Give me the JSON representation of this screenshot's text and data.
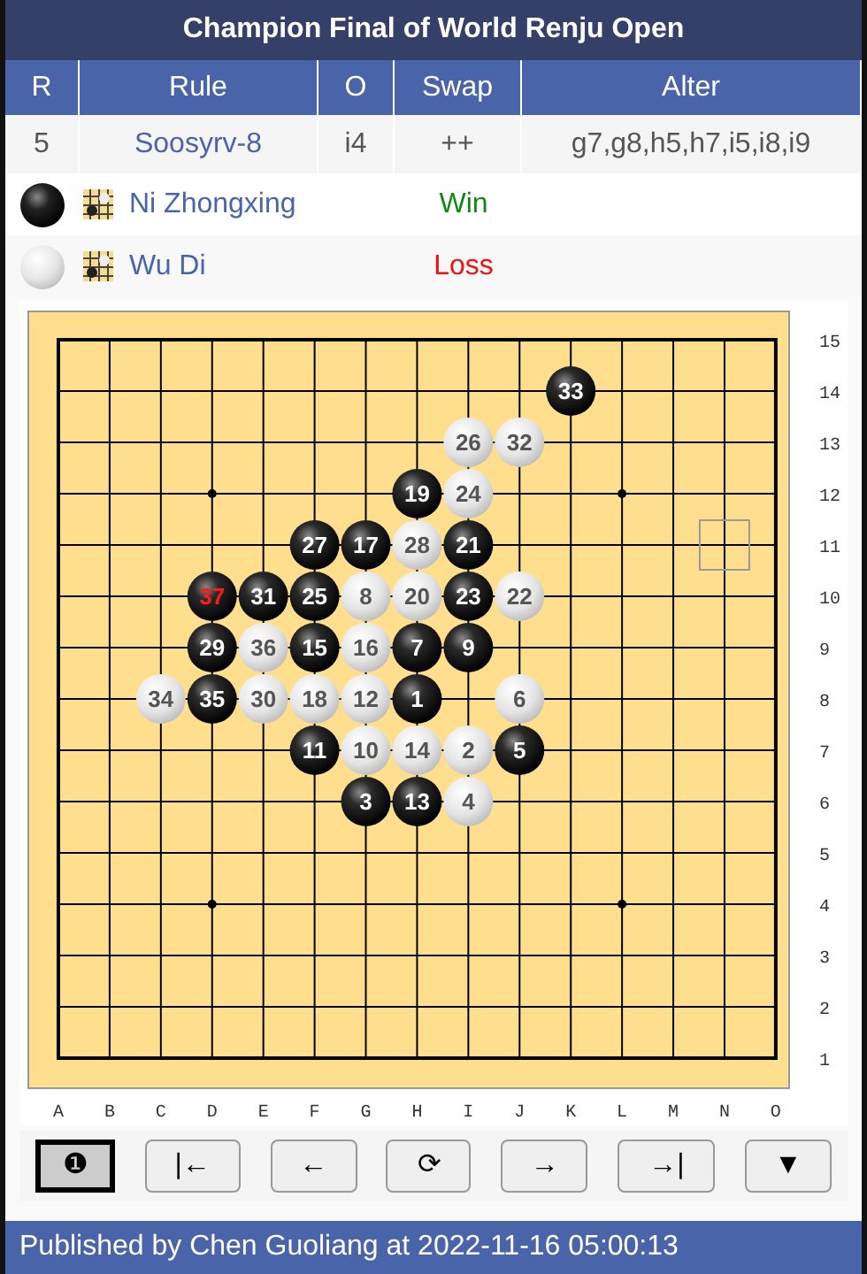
{
  "title": "Champion Final of World Renju Open",
  "info_table": {
    "columns": [
      "R",
      "Rule",
      "O",
      "Swap",
      "Alter"
    ],
    "row": [
      "5",
      "Soosyrv-8",
      "i4",
      "++",
      "g7,g8,h5,h7,i5,i8,i9"
    ]
  },
  "players": [
    {
      "kind": "black",
      "name": "Ni Zhongxing",
      "result": "Win",
      "won": true
    },
    {
      "kind": "white",
      "name": "Wu Di",
      "result": "Loss",
      "won": false
    }
  ],
  "board": {
    "column_labels": [
      "A",
      "B",
      "C",
      "D",
      "E",
      "F",
      "G",
      "H",
      "I",
      "J",
      "K",
      "L",
      "M",
      "N",
      "O"
    ],
    "row_labels": [
      "15",
      "14",
      "13",
      "12",
      "11",
      "10",
      "9",
      "8",
      "7",
      "6",
      "5",
      "4",
      "3",
      "2",
      "1"
    ],
    "rows": [
      {
        "points": [
          {
            "kind": "empty"
          },
          {
            "kind": "empty"
          },
          {
            "kind": "empty"
          },
          {
            "kind": "empty"
          },
          {
            "kind": "empty"
          },
          {
            "kind": "empty"
          },
          {
            "kind": "empty"
          },
          {
            "kind": "empty"
          },
          {
            "kind": "empty"
          },
          {
            "kind": "empty"
          },
          {
            "kind": "empty"
          },
          {
            "kind": "empty"
          },
          {
            "kind": "empty"
          },
          {
            "kind": "empty"
          },
          {
            "kind": "empty"
          }
        ]
      },
      {
        "points": [
          {
            "kind": "empty"
          },
          {
            "kind": "empty"
          },
          {
            "kind": "empty"
          },
          {
            "kind": "empty"
          },
          {
            "kind": "empty"
          },
          {
            "kind": "empty"
          },
          {
            "kind": "empty"
          },
          {
            "kind": "empty"
          },
          {
            "kind": "empty"
          },
          {
            "kind": "empty"
          },
          {
            "kind": "black",
            "move": "33",
            "last": false
          },
          {
            "kind": "empty"
          },
          {
            "kind": "empty"
          },
          {
            "kind": "empty"
          },
          {
            "kind": "empty"
          }
        ]
      },
      {
        "points": [
          {
            "kind": "empty"
          },
          {
            "kind": "empty"
          },
          {
            "kind": "empty"
          },
          {
            "kind": "empty"
          },
          {
            "kind": "empty"
          },
          {
            "kind": "empty"
          },
          {
            "kind": "empty"
          },
          {
            "kind": "empty"
          },
          {
            "kind": "white",
            "move": "26",
            "last": false
          },
          {
            "kind": "white",
            "move": "32",
            "last": false
          },
          {
            "kind": "empty"
          },
          {
            "kind": "empty"
          },
          {
            "kind": "empty"
          },
          {
            "kind": "empty"
          },
          {
            "kind": "empty"
          }
        ]
      },
      {
        "points": [
          {
            "kind": "empty"
          },
          {
            "kind": "empty"
          },
          {
            "kind": "empty"
          },
          {
            "kind": "empty"
          },
          {
            "kind": "empty"
          },
          {
            "kind": "empty"
          },
          {
            "kind": "empty"
          },
          {
            "kind": "black",
            "move": "19",
            "last": false
          },
          {
            "kind": "white",
            "move": "24",
            "last": false
          },
          {
            "kind": "empty"
          },
          {
            "kind": "empty"
          },
          {
            "kind": "empty"
          },
          {
            "kind": "empty"
          },
          {
            "kind": "empty"
          },
          {
            "kind": "empty"
          }
        ]
      },
      {
        "points": [
          {
            "kind": "empty"
          },
          {
            "kind": "empty"
          },
          {
            "kind": "empty"
          },
          {
            "kind": "empty"
          },
          {
            "kind": "empty"
          },
          {
            "kind": "black",
            "move": "27",
            "last": false
          },
          {
            "kind": "black",
            "move": "17",
            "last": false
          },
          {
            "kind": "white",
            "move": "28",
            "last": false
          },
          {
            "kind": "black",
            "move": "21",
            "last": false
          },
          {
            "kind": "empty"
          },
          {
            "kind": "empty"
          },
          {
            "kind": "empty"
          },
          {
            "kind": "empty"
          },
          {
            "kind": "square"
          },
          {
            "kind": "empty"
          }
        ]
      },
      {
        "points": [
          {
            "kind": "empty"
          },
          {
            "kind": "empty"
          },
          {
            "kind": "empty"
          },
          {
            "kind": "black",
            "move": "37",
            "last": true
          },
          {
            "kind": "black",
            "move": "31",
            "last": false
          },
          {
            "kind": "black",
            "move": "25",
            "last": false
          },
          {
            "kind": "white",
            "move": "8",
            "last": false
          },
          {
            "kind": "white",
            "move": "20",
            "last": false
          },
          {
            "kind": "black",
            "move": "23",
            "last": false
          },
          {
            "kind": "white",
            "move": "22",
            "last": false
          },
          {
            "kind": "empty"
          },
          {
            "kind": "empty"
          },
          {
            "kind": "empty"
          },
          {
            "kind": "empty"
          },
          {
            "kind": "empty"
          }
        ]
      },
      {
        "points": [
          {
            "kind": "empty"
          },
          {
            "kind": "empty"
          },
          {
            "kind": "empty"
          },
          {
            "kind": "black",
            "move": "29",
            "last": false
          },
          {
            "kind": "white",
            "move": "36",
            "last": false
          },
          {
            "kind": "black",
            "move": "15",
            "last": false
          },
          {
            "kind": "white",
            "move": "16",
            "last": false
          },
          {
            "kind": "black",
            "move": "7",
            "last": false
          },
          {
            "kind": "black",
            "move": "9",
            "last": false
          },
          {
            "kind": "empty"
          },
          {
            "kind": "empty"
          },
          {
            "kind": "empty"
          },
          {
            "kind": "empty"
          },
          {
            "kind": "empty"
          },
          {
            "kind": "empty"
          }
        ]
      },
      {
        "points": [
          {
            "kind": "empty"
          },
          {
            "kind": "empty"
          },
          {
            "kind": "white",
            "move": "34",
            "last": false
          },
          {
            "kind": "black",
            "move": "35",
            "last": false
          },
          {
            "kind": "white",
            "move": "30",
            "last": false
          },
          {
            "kind": "white",
            "move": "18",
            "last": false
          },
          {
            "kind": "white",
            "move": "12",
            "last": false
          },
          {
            "kind": "black",
            "move": "1",
            "last": false
          },
          {
            "kind": "empty"
          },
          {
            "kind": "white",
            "move": "6",
            "last": false
          },
          {
            "kind": "empty"
          },
          {
            "kind": "empty"
          },
          {
            "kind": "empty"
          },
          {
            "kind": "empty"
          },
          {
            "kind": "empty"
          }
        ]
      },
      {
        "points": [
          {
            "kind": "empty"
          },
          {
            "kind": "empty"
          },
          {
            "kind": "empty"
          },
          {
            "kind": "empty"
          },
          {
            "kind": "empty"
          },
          {
            "kind": "black",
            "move": "11",
            "last": false
          },
          {
            "kind": "white",
            "move": "10",
            "last": false
          },
          {
            "kind": "white",
            "move": "14",
            "last": false
          },
          {
            "kind": "white",
            "move": "2",
            "last": false
          },
          {
            "kind": "black",
            "move": "5",
            "last": false
          },
          {
            "kind": "empty"
          },
          {
            "kind": "empty"
          },
          {
            "kind": "empty"
          },
          {
            "kind": "empty"
          },
          {
            "kind": "empty"
          }
        ]
      },
      {
        "points": [
          {
            "kind": "empty"
          },
          {
            "kind": "empty"
          },
          {
            "kind": "empty"
          },
          {
            "kind": "empty"
          },
          {
            "kind": "empty"
          },
          {
            "kind": "empty"
          },
          {
            "kind": "black",
            "move": "3",
            "last": false
          },
          {
            "kind": "black",
            "move": "13",
            "last": false
          },
          {
            "kind": "white",
            "move": "4",
            "last": false
          },
          {
            "kind": "empty"
          },
          {
            "kind": "empty"
          },
          {
            "kind": "empty"
          },
          {
            "kind": "empty"
          },
          {
            "kind": "empty"
          },
          {
            "kind": "empty"
          }
        ]
      },
      {
        "points": [
          {
            "kind": "empty"
          },
          {
            "kind": "empty"
          },
          {
            "kind": "empty"
          },
          {
            "kind": "empty"
          },
          {
            "kind": "empty"
          },
          {
            "kind": "empty"
          },
          {
            "kind": "empty"
          },
          {
            "kind": "empty"
          },
          {
            "kind": "empty"
          },
          {
            "kind": "empty"
          },
          {
            "kind": "empty"
          },
          {
            "kind": "empty"
          },
          {
            "kind": "empty"
          },
          {
            "kind": "empty"
          },
          {
            "kind": "empty"
          }
        ]
      },
      {
        "points": [
          {
            "kind": "empty"
          },
          {
            "kind": "empty"
          },
          {
            "kind": "empty"
          },
          {
            "kind": "empty"
          },
          {
            "kind": "empty"
          },
          {
            "kind": "empty"
          },
          {
            "kind": "empty"
          },
          {
            "kind": "empty"
          },
          {
            "kind": "empty"
          },
          {
            "kind": "empty"
          },
          {
            "kind": "empty"
          },
          {
            "kind": "empty"
          },
          {
            "kind": "empty"
          },
          {
            "kind": "empty"
          },
          {
            "kind": "empty"
          }
        ]
      },
      {
        "points": [
          {
            "kind": "empty"
          },
          {
            "kind": "empty"
          },
          {
            "kind": "empty"
          },
          {
            "kind": "empty"
          },
          {
            "kind": "empty"
          },
          {
            "kind": "empty"
          },
          {
            "kind": "empty"
          },
          {
            "kind": "empty"
          },
          {
            "kind": "empty"
          },
          {
            "kind": "empty"
          },
          {
            "kind": "empty"
          },
          {
            "kind": "empty"
          },
          {
            "kind": "empty"
          },
          {
            "kind": "empty"
          },
          {
            "kind": "empty"
          }
        ]
      },
      {
        "points": [
          {
            "kind": "empty"
          },
          {
            "kind": "empty"
          },
          {
            "kind": "empty"
          },
          {
            "kind": "empty"
          },
          {
            "kind": "empty"
          },
          {
            "kind": "empty"
          },
          {
            "kind": "empty"
          },
          {
            "kind": "empty"
          },
          {
            "kind": "empty"
          },
          {
            "kind": "empty"
          },
          {
            "kind": "empty"
          },
          {
            "kind": "empty"
          },
          {
            "kind": "empty"
          },
          {
            "kind": "empty"
          },
          {
            "kind": "empty"
          }
        ]
      },
      {
        "points": [
          {
            "kind": "empty"
          },
          {
            "kind": "empty"
          },
          {
            "kind": "empty"
          },
          {
            "kind": "empty"
          },
          {
            "kind": "empty"
          },
          {
            "kind": "empty"
          },
          {
            "kind": "empty"
          },
          {
            "kind": "empty"
          },
          {
            "kind": "empty"
          },
          {
            "kind": "empty"
          },
          {
            "kind": "empty"
          },
          {
            "kind": "empty"
          },
          {
            "kind": "empty"
          },
          {
            "kind": "empty"
          },
          {
            "kind": "empty"
          }
        ]
      }
    ]
  },
  "controls": [
    {
      "label": "❶",
      "selected": true
    },
    {
      "label": "|←",
      "selected": false
    },
    {
      "label": "←",
      "selected": false
    },
    {
      "label": "⟳",
      "selected": false
    },
    {
      "label": "→",
      "selected": false
    },
    {
      "label": "→|",
      "selected": false
    },
    {
      "label": "▼",
      "selected": false
    }
  ],
  "footer": "Published by Chen Guoliang at 2022-11-16 05:00:13"
}
